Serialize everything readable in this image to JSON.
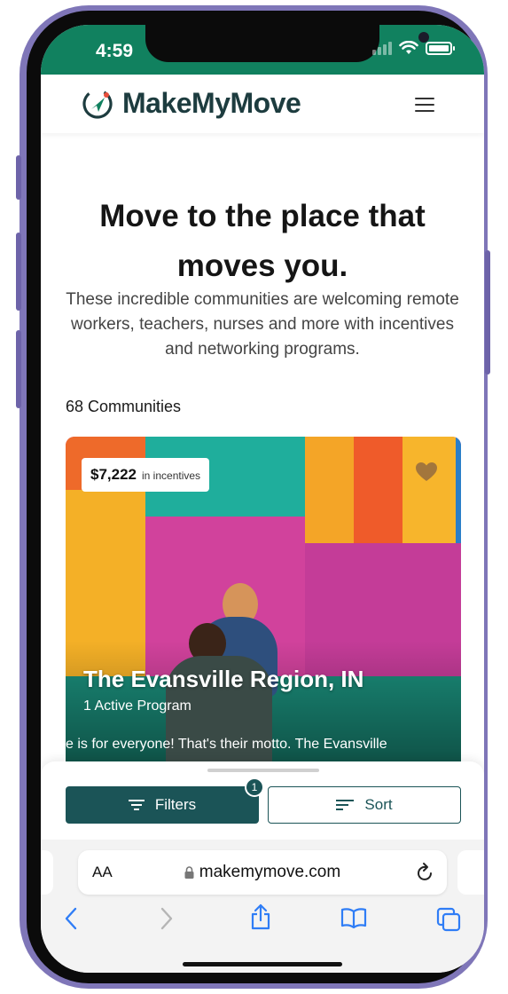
{
  "status": {
    "time": "4:59"
  },
  "brand": {
    "name": "MakeMyMove",
    "accent": "#11815f",
    "dark": "#1b5457"
  },
  "hero": {
    "title": "Move to the place that moves you.",
    "subtitle": "These incredible communities are welcoming remote workers, teachers, nurses and more with incentives and networking programs."
  },
  "results": {
    "count_label": "68 Communities"
  },
  "card": {
    "incentive_amount": "$7,222",
    "incentive_label": "in incentives",
    "title": "The Evansville Region, IN",
    "programs": "1 Active Program",
    "description": "e is for everyone! That's their motto. The Evansville"
  },
  "actions": {
    "filters_label": "Filters",
    "filters_count": "1",
    "sort_label": "Sort"
  },
  "browser": {
    "aa_label": "AA",
    "url": "makemymove.com"
  }
}
